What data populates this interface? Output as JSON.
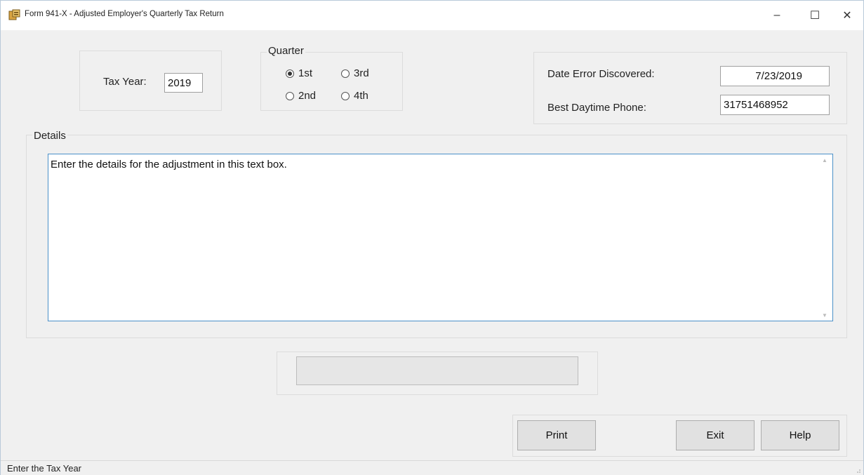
{
  "window": {
    "title": "Form 941-X - Adjusted Employer's Quarterly Tax Return",
    "minimize_glyph": "–",
    "maximize_glyph": "☐",
    "close_glyph": "✕"
  },
  "tax_year": {
    "label": "Tax Year:",
    "value": "2019"
  },
  "quarter": {
    "legend": "Quarter",
    "options": [
      "1st",
      "2nd",
      "3rd",
      "4th"
    ],
    "selected": "1st"
  },
  "contact": {
    "date_label": "Date Error Discovered:",
    "date_value": "7/23/2019",
    "phone_label": "Best Daytime Phone:",
    "phone_value": "31751468952"
  },
  "details": {
    "legend": "Details",
    "text": "Enter the details for the adjustment in this text box."
  },
  "buttons": {
    "print": "Print",
    "exit": "Exit",
    "help": "Help"
  },
  "status": {
    "text": "Enter the Tax Year"
  },
  "icons": {
    "app": "form-app-icon",
    "minimize": "minimize-icon",
    "maximize": "maximize-icon",
    "close": "close-icon"
  },
  "colors": {
    "focus_border": "#4a90c8",
    "window_bg": "#f0f0f0",
    "titlebar_bg": "#ffffff"
  }
}
